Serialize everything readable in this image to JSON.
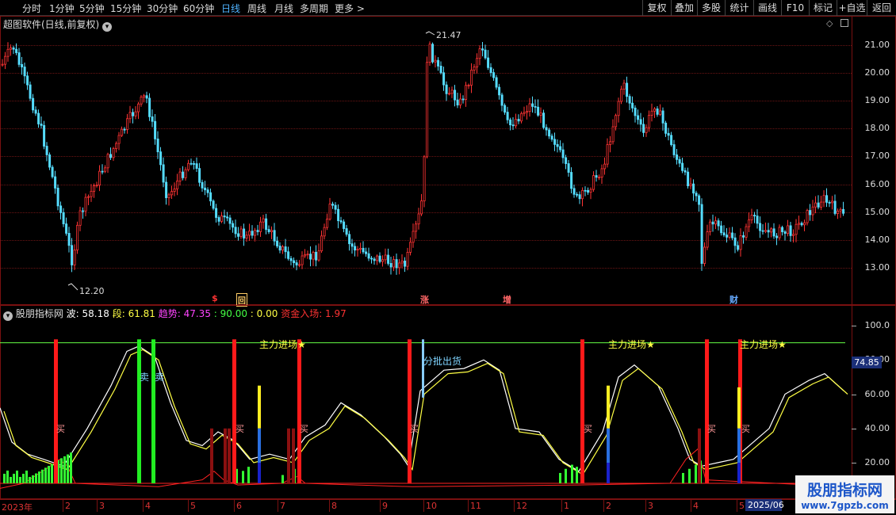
{
  "toolbar": {
    "timeframes": [
      "分时",
      "1分钟",
      "5分钟",
      "15分钟",
      "30分钟",
      "60分钟",
      "日线",
      "周线",
      "月线",
      "多周期",
      "更多 >"
    ],
    "active": "日线",
    "buttons": [
      "复权",
      "叠加",
      "多股",
      "统计",
      "画线",
      "F10",
      "标记",
      "+自选",
      "返回"
    ]
  },
  "main_panel": {
    "title": "超图软件(日线,前复权)",
    "high_label": "21.47",
    "low_label": "12.20",
    "y_ticks": [
      "21.00",
      "20.00",
      "19.00",
      "18.00",
      "17.00",
      "16.00",
      "15.00",
      "14.00",
      "13.00"
    ],
    "markers": [
      {
        "text": "$",
        "color": "#ff3333"
      },
      {
        "text": "回",
        "color": "#ffcc66"
      },
      {
        "text": "涨",
        "color": "#ff6666"
      },
      {
        "text": "增",
        "color": "#ff6666"
      },
      {
        "text": "财",
        "color": "#66aaff"
      }
    ]
  },
  "indicator_panel": {
    "name": "股朋指标网",
    "values": [
      {
        "label": "波: ",
        "value": "58.18",
        "color": "#ffffff"
      },
      {
        "label": "段: ",
        "value": "61.81",
        "color": "#ffff44"
      },
      {
        "label": "趋势: ",
        "value": "47.35",
        "color": "#ff44ff"
      },
      {
        "label": "",
        "value": ": 90.00",
        "color": "#44ff44"
      },
      {
        "label": "",
        "value": ": 0.00",
        "color": "#ffff44"
      },
      {
        "label": "资金入场: ",
        "value": "1.97",
        "color": "#ff3333"
      }
    ],
    "y_ticks": [
      "100.0",
      "80.00",
      "60.00",
      "40.00",
      "20.00"
    ],
    "current_value": "74.85",
    "annotations": {
      "main_entry": "主力进场★",
      "batch_sell": "分批出货",
      "sell": "卖",
      "buy": "买"
    }
  },
  "x_axis": {
    "labels": [
      "2023年",
      "2",
      "3",
      "4",
      "5",
      "6",
      "7",
      "8",
      "9",
      "10",
      "11",
      "12",
      "1",
      "2",
      "3",
      "4",
      "5"
    ],
    "current_date": "2025/06"
  },
  "watermark": {
    "title": "股朋指标网",
    "url": "www.7gpzb.com"
  },
  "colors": {
    "up": "#ff3333",
    "down": "#55ddff",
    "background": "#000000",
    "grid": "#6a1414"
  }
}
